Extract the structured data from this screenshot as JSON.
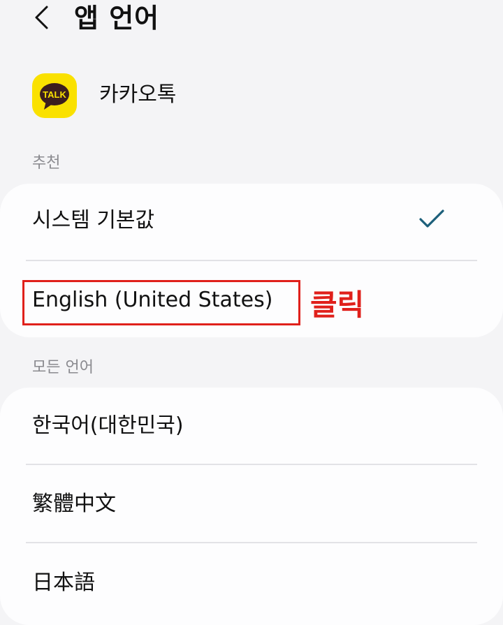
{
  "header": {
    "title": "앱 언어",
    "back_icon": "chevron-left-icon"
  },
  "app": {
    "name": "카카오톡",
    "icon_label": "TALK",
    "icon_color": "#fae100",
    "bubble_color": "#3c1e1e"
  },
  "suggested": {
    "label": "추천",
    "items": [
      {
        "label": "시스템 기본값",
        "selected": true
      },
      {
        "label": "English (United States)",
        "selected": false
      }
    ]
  },
  "all_languages": {
    "label": "모든 언어",
    "items": [
      {
        "label": "한국어(대한민국)"
      },
      {
        "label": "繁體中文"
      },
      {
        "label": "日本語"
      }
    ]
  },
  "annotation": {
    "text": "클릭",
    "color": "#e0201b"
  },
  "colors": {
    "accent_check": "#1c5f7a",
    "background": "#f4f4f6",
    "card": "#fdfdfe"
  }
}
